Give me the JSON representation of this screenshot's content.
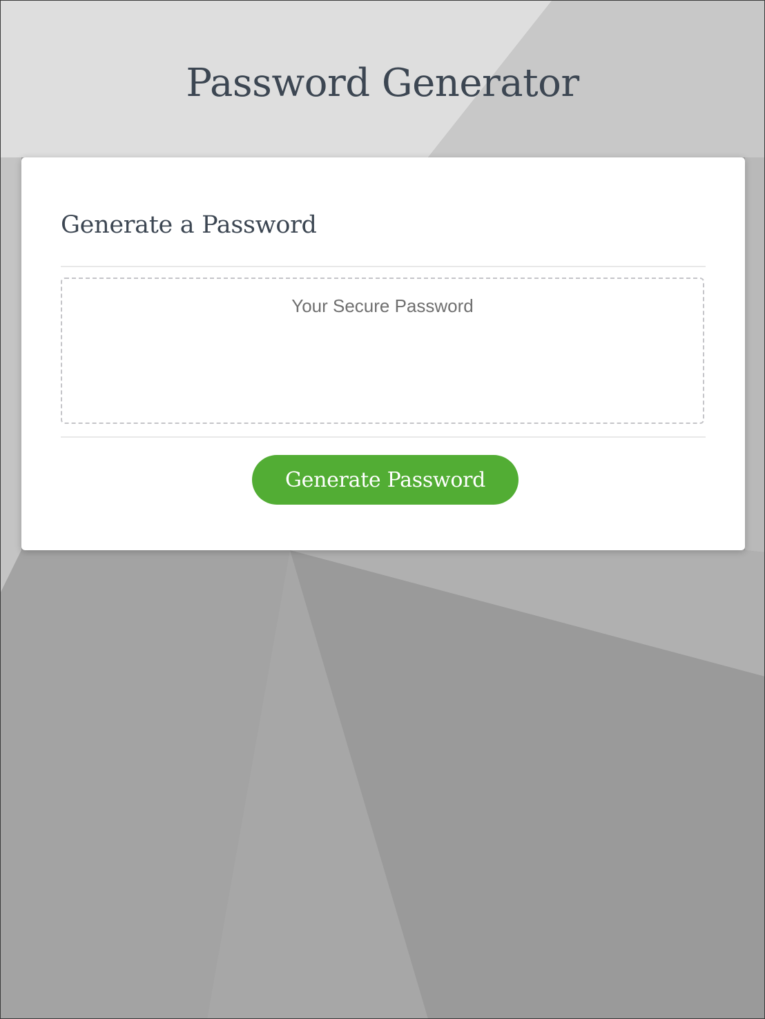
{
  "header": {
    "title": "Password Generator"
  },
  "card": {
    "title": "Generate a Password",
    "password_field": {
      "value": "",
      "placeholder": "Your Secure Password"
    },
    "generate_button_label": "Generate Password"
  },
  "colors": {
    "button_green": "#52ad34",
    "title_text": "#3c4652",
    "card_background": "#ffffff"
  }
}
